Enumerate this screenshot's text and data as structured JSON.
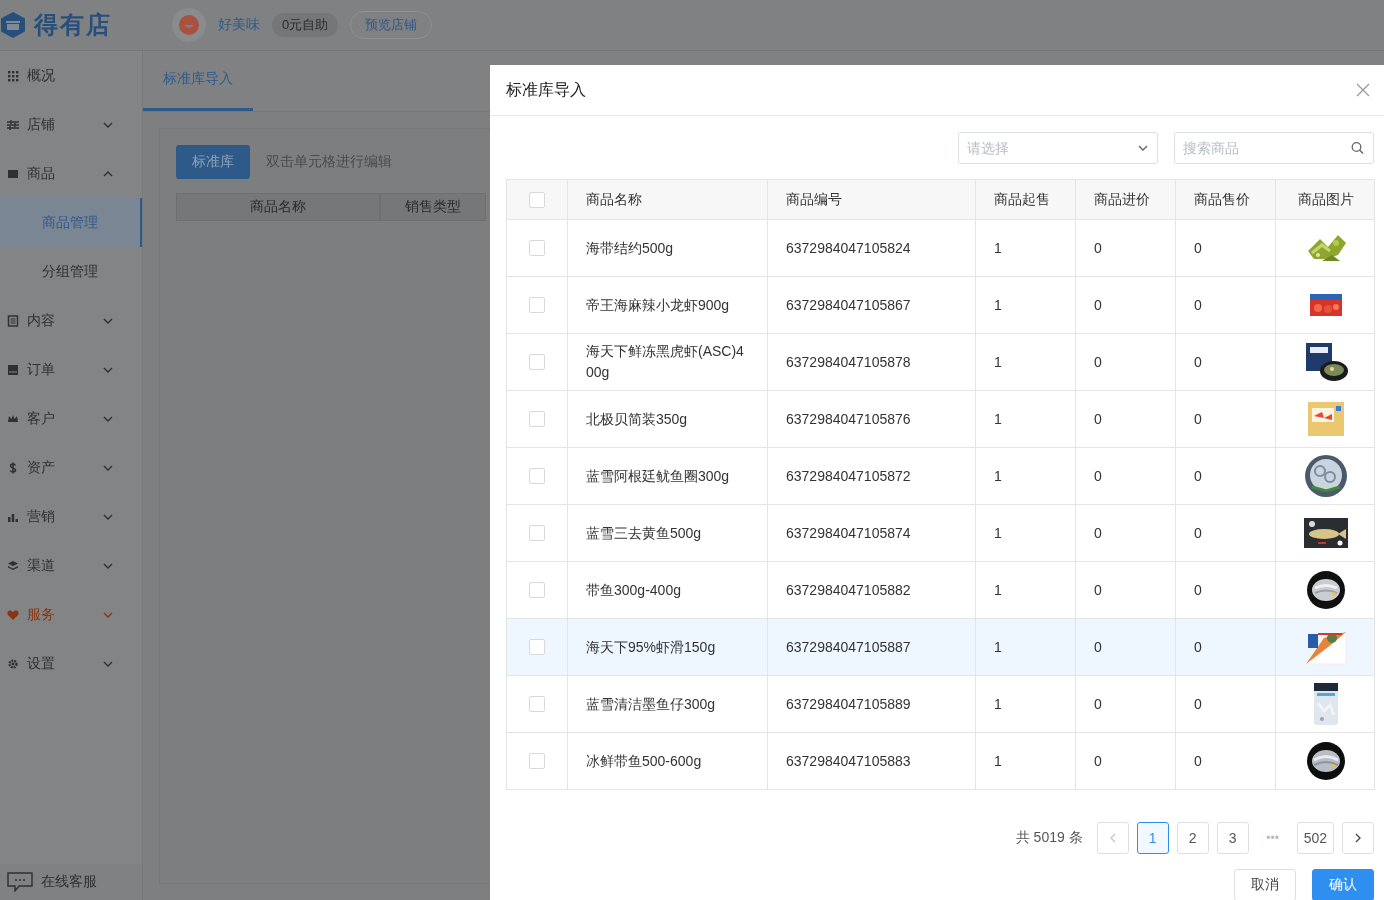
{
  "header": {
    "logo": "得有店",
    "shop_name": "好美味",
    "plan_badge": "0元自助",
    "preview_button": "预览店铺"
  },
  "sidebar": {
    "items": [
      {
        "label": "概况",
        "color": "#2f3033"
      },
      {
        "label": "店铺",
        "expanded": false,
        "color": "#2f3033"
      },
      {
        "label": "商品",
        "expanded": true,
        "color": "#2f3033",
        "children": [
          {
            "label": "商品管理",
            "selected": true
          },
          {
            "label": "分组管理",
            "selected": false
          }
        ]
      },
      {
        "label": "内容",
        "expanded": false,
        "color": "#2f3033"
      },
      {
        "label": "订单",
        "expanded": false,
        "color": "#2f3033"
      },
      {
        "label": "客户",
        "expanded": false,
        "color": "#2f3033"
      },
      {
        "label": "资产",
        "expanded": false,
        "color": "#2f3033"
      },
      {
        "label": "营销",
        "expanded": false,
        "color": "#2f3033"
      },
      {
        "label": "渠道",
        "expanded": false,
        "color": "#2f3033"
      },
      {
        "label": "服务",
        "expanded": false,
        "color": "#8a3512"
      },
      {
        "label": "设置",
        "expanded": false,
        "color": "#2f3033"
      }
    ],
    "support_link": "在线客服"
  },
  "content": {
    "tabs": [
      {
        "label": "标准库导入",
        "selected": true
      }
    ],
    "library_button": "标准库",
    "hint": "双击单元格进行编辑",
    "columns": [
      "商品名称",
      "销售类型"
    ]
  },
  "dialog": {
    "title": "标准库导入",
    "category_select": {
      "placeholder": "请选择"
    },
    "search": {
      "placeholder": "搜索商品"
    },
    "select_all_checked": false,
    "columns": [
      "商品名称",
      "商品编号",
      "商品起售",
      "商品进价",
      "商品售价",
      "商品图片"
    ],
    "rows": [
      {
        "name": "海带结约500g",
        "code": "6372984047105824",
        "min_qty": "1",
        "cost": "0",
        "price": "0",
        "checked": false,
        "highlighted": false
      },
      {
        "name": "帝王海麻辣小龙虾900g",
        "code": "6372984047105867",
        "min_qty": "1",
        "cost": "0",
        "price": "0",
        "checked": false,
        "highlighted": false
      },
      {
        "name": "海天下鲜冻黑虎虾(ASC)400g",
        "code": "6372984047105878",
        "min_qty": "1",
        "cost": "0",
        "price": "0",
        "checked": false,
        "highlighted": false
      },
      {
        "name": "北极贝简装350g",
        "code": "6372984047105876",
        "min_qty": "1",
        "cost": "0",
        "price": "0",
        "checked": false,
        "highlighted": false
      },
      {
        "name": "蓝雪阿根廷鱿鱼圈300g",
        "code": "6372984047105872",
        "min_qty": "1",
        "cost": "0",
        "price": "0",
        "checked": false,
        "highlighted": false
      },
      {
        "name": "蓝雪三去黄鱼500g",
        "code": "6372984047105874",
        "min_qty": "1",
        "cost": "0",
        "price": "0",
        "checked": false,
        "highlighted": false
      },
      {
        "name": "带鱼300g-400g",
        "code": "6372984047105882",
        "min_qty": "1",
        "cost": "0",
        "price": "0",
        "checked": false,
        "highlighted": false
      },
      {
        "name": "海天下95%虾滑150g",
        "code": "6372984047105887",
        "min_qty": "1",
        "cost": "0",
        "price": "0",
        "checked": false,
        "highlighted": true
      },
      {
        "name": "蓝雪清洁墨鱼仔300g",
        "code": "6372984047105889",
        "min_qty": "1",
        "cost": "0",
        "price": "0",
        "checked": false,
        "highlighted": false
      },
      {
        "name": "冰鲜带鱼500-600g",
        "code": "6372984047105883",
        "min_qty": "1",
        "cost": "0",
        "price": "0",
        "checked": false,
        "highlighted": false
      }
    ],
    "pagination": {
      "total": "共 5019 条",
      "prev_disabled": true,
      "next_disabled": false,
      "pages": [
        {
          "label": "1",
          "selected": true
        },
        {
          "label": "2",
          "selected": false
        },
        {
          "label": "3",
          "selected": false
        }
      ],
      "ellipsis": "•••",
      "last_page": {
        "label": "502",
        "selected": false
      }
    },
    "buttons": {
      "cancel": "取消",
      "confirm": "确认"
    }
  }
}
